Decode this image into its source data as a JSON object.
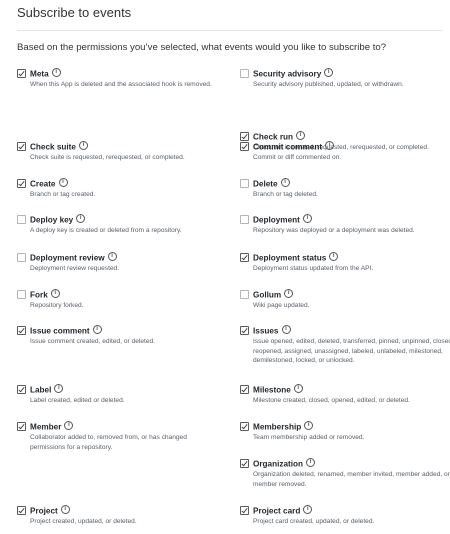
{
  "header": {
    "title": "Subscribe to events",
    "subtitle": "Based on the permissions you’ve selected, what events would you like to subscribe to?"
  },
  "events": [
    {
      "name": "Meta",
      "desc": "When this App is deleted and the associated hook is removed.",
      "checked": true
    },
    {
      "name": "Security advisory",
      "desc": "Security advisory published, updated, or withdrawn.",
      "checked": false
    },
    {
      "name": "Check run",
      "desc": "Check run is created, requested, rerequested, or completed.",
      "checked": true
    },
    {
      "name": "Check suite",
      "desc": "Check suite is requested, rerequested, or completed.",
      "checked": true
    },
    {
      "name": "Commit comment",
      "desc": "Commit or diff commented on.",
      "checked": true
    },
    {
      "name": "Create",
      "desc": "Branch or tag created.",
      "checked": true
    },
    {
      "name": "Delete",
      "desc": "Branch or tag deleted.",
      "checked": false
    },
    {
      "name": "Deploy key",
      "desc": "A deploy key is created or deleted from a repository.",
      "checked": false
    },
    {
      "name": "Deployment",
      "desc": "Repository was deployed or a deployment was deleted.",
      "checked": false
    },
    {
      "name": "Deployment review",
      "desc": "Deployment review requested.",
      "checked": false
    },
    {
      "name": "Deployment status",
      "desc": "Deployment status updated from the API.",
      "checked": true
    },
    {
      "name": "Fork",
      "desc": "Repository forked.",
      "checked": false
    },
    {
      "name": "Gollum",
      "desc": "Wiki page updated.",
      "checked": false
    },
    {
      "name": "Issue comment",
      "desc": "Issue comment created, edited, or deleted.",
      "checked": true
    },
    {
      "name": "Issues",
      "desc": "Issue opened, edited, deleted, transferred, pinned, unpinned, closed, reopened, assigned, unassigned, labeled, unlabeled, milestoned, demilestoned, locked, or unlocked.",
      "checked": true
    },
    {
      "name": "Label",
      "desc": "Label created, edited or deleted.",
      "checked": true
    },
    {
      "name": "Milestone",
      "desc": "Milestone created, closed, opened, edited, or deleted.",
      "checked": true
    },
    {
      "name": "Member",
      "desc": "Collaborator added to, removed from, or has changed permissions for a repository.",
      "checked": true
    },
    {
      "name": "Membership",
      "desc": "Team membership added or removed.",
      "checked": true
    },
    {
      "name": "Organization",
      "desc": "Organization deleted, renamed, member invited, member added, or member removed.",
      "checked": true
    },
    {
      "name": "Project",
      "desc": "Project created, updated, or deleted.",
      "checked": true
    },
    {
      "name": "Project card",
      "desc": "Project card created, updated, or deleted.",
      "checked": true
    }
  ]
}
